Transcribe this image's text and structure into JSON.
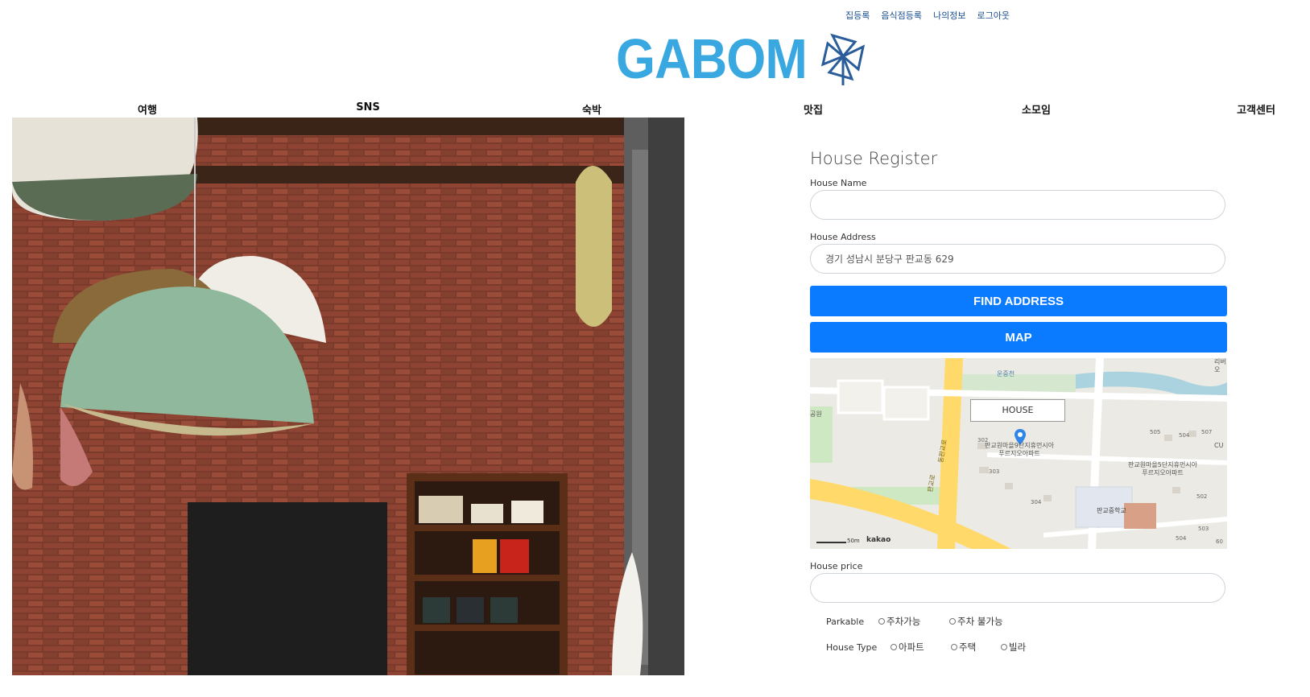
{
  "header": {
    "top_links": [
      "집등록",
      "음식점등록",
      "나의정보",
      "로그아웃"
    ],
    "logo_text": "GABOM"
  },
  "nav": {
    "items": [
      "여행",
      "SNS",
      "숙박",
      "맛집",
      "소모임",
      "고객센터"
    ]
  },
  "form": {
    "title": "House Register",
    "house_name_label": "House Name",
    "house_name_value": "",
    "house_address_label": "House Address",
    "house_address_value": "경기 성남시 분당구 판교동 629",
    "find_address_button": "FIND ADDRESS",
    "map_button": "MAP",
    "map": {
      "marker_label": "HOUSE",
      "places": [
        "판교원마을9단지휴먼시아\n푸르지오아파트",
        "판교원마을5단지휴먼시아\n푸르지오아파트",
        "판교중학교",
        "공원",
        "운중천",
        "리버\n오"
      ],
      "road_names": [
        "동판교로",
        "판교로"
      ],
      "building_numbers": [
        "302",
        "303",
        "304",
        "505",
        "504",
        "507",
        "502",
        "503",
        "504",
        "60"
      ],
      "store_label": "CU",
      "scale_text": "50m",
      "brand_text": "kakao"
    },
    "house_price_label": "House price",
    "house_price_value": "",
    "parkable_label": "Parkable",
    "parkable_options": [
      "주차가능",
      "주차 불가능"
    ],
    "house_type_label": "House Type",
    "house_type_options": [
      "아파트",
      "주택",
      "빌라"
    ]
  },
  "colors": {
    "accent": "#0a7bff",
    "logo": "#3aa8e0",
    "top_link": "#1a4f8f"
  }
}
